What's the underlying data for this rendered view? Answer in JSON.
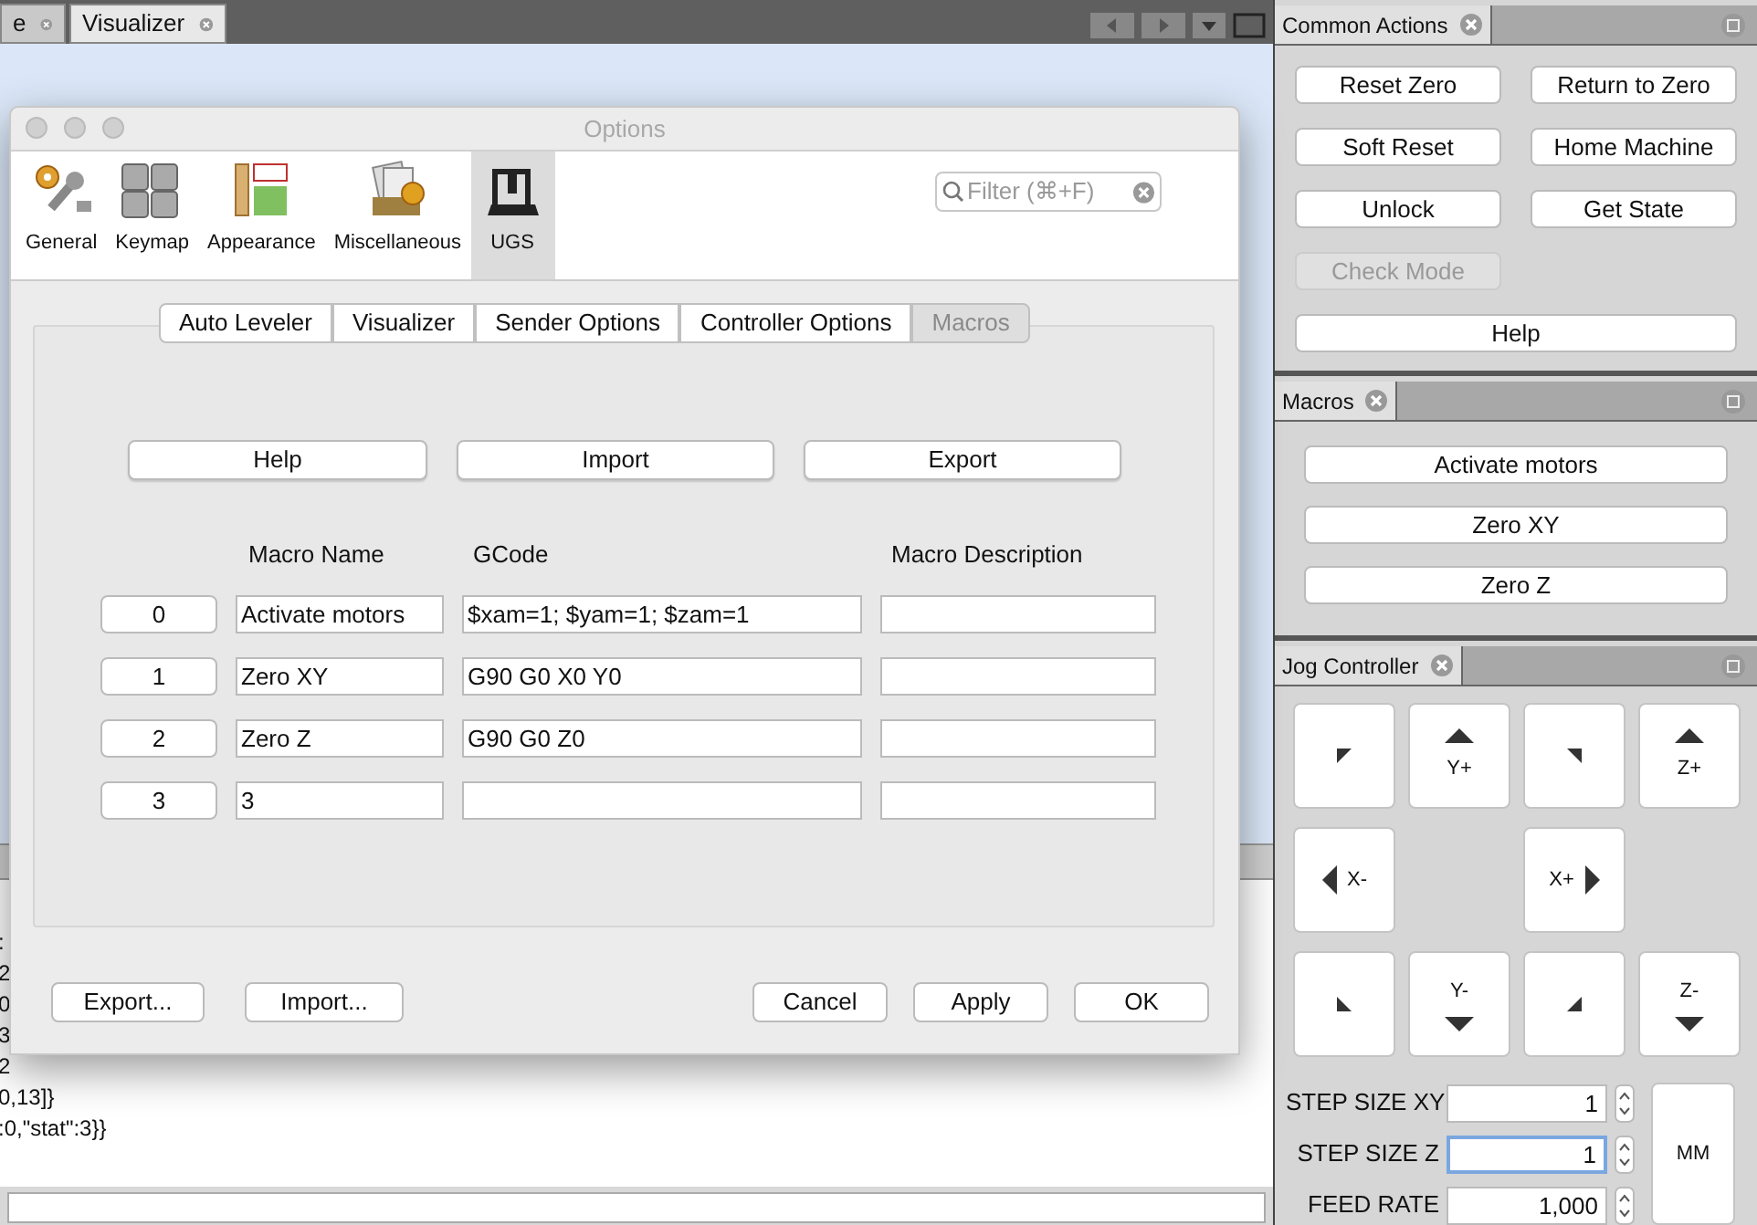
{
  "editor_tabs": [
    {
      "label": "e",
      "selected": false
    },
    {
      "label": "Visualizer",
      "selected": true
    }
  ],
  "console": {
    "lines": [
      ":",
      "2",
      "0",
      "3",
      "2",
      "0,13]}",
      ":0,\"stat\":3}}"
    ]
  },
  "dialog": {
    "title": "Options",
    "categories": [
      {
        "label": "General",
        "kind": "general",
        "selected": false
      },
      {
        "label": "Keymap",
        "kind": "keymap",
        "selected": false
      },
      {
        "label": "Appearance",
        "kind": "appearance",
        "selected": false
      },
      {
        "label": "Miscellaneous",
        "kind": "misc",
        "selected": false
      },
      {
        "label": "UGS",
        "kind": "ugs",
        "selected": true
      }
    ],
    "filter": {
      "placeholder": "Filter (⌘+F)"
    },
    "tabs": [
      {
        "label": "Auto Leveler",
        "selected": false
      },
      {
        "label": "Visualizer",
        "selected": false
      },
      {
        "label": "Sender Options",
        "selected": false
      },
      {
        "label": "Controller Options",
        "selected": false
      },
      {
        "label": "Macros",
        "selected": true
      }
    ],
    "top_buttons": [
      "Help",
      "Import",
      "Export"
    ],
    "columns": [
      "Macro Name",
      "GCode",
      "Macro Description"
    ],
    "macros": [
      {
        "index": "0",
        "name": "Activate motors",
        "gcode": "$xam=1; $yam=1; $zam=1"
      },
      {
        "index": "1",
        "name": "Zero XY",
        "gcode": "G90 G0 X0 Y0"
      },
      {
        "index": "2",
        "name": "Zero Z",
        "gcode": "G90 G0 Z0"
      },
      {
        "index": "3",
        "name": "3"
      }
    ],
    "left_buttons": [
      "Export...",
      "Import..."
    ],
    "right_buttons": [
      "Cancel",
      "Apply",
      "OK"
    ]
  },
  "common_actions": {
    "title": "Common Actions",
    "buttons": [
      {
        "label": "Reset Zero",
        "disabled": false
      },
      {
        "label": "Return to Zero",
        "disabled": false
      },
      {
        "label": "Soft Reset",
        "disabled": false
      },
      {
        "label": "Home Machine",
        "disabled": false
      },
      {
        "label": "Unlock",
        "disabled": false
      },
      {
        "label": "Get State",
        "disabled": false
      },
      {
        "label": "Check Mode",
        "disabled": true
      }
    ],
    "help": "Help"
  },
  "macros_panel": {
    "title": "Macros",
    "buttons": [
      "Activate motors",
      "Zero XY",
      "Zero Z"
    ]
  },
  "jog": {
    "title": "Jog Controller",
    "pad": [
      {
        "kind": "ul"
      },
      {
        "kind": "up",
        "label": "Y+"
      },
      {
        "kind": "ur"
      },
      {
        "kind": "up",
        "label": "Z+"
      },
      {
        "kind": "left",
        "label": "X-"
      },
      {
        "kind": "empty"
      },
      {
        "kind": "right",
        "label": "X+"
      },
      {
        "kind": "empty"
      },
      {
        "kind": "dl"
      },
      {
        "kind": "down",
        "label": "Y-"
      },
      {
        "kind": "dr"
      },
      {
        "kind": "down",
        "label": "Z-"
      }
    ],
    "fields": [
      {
        "label": "STEP SIZE XY",
        "value": "1",
        "focused": false
      },
      {
        "label": "STEP SIZE Z",
        "value": "1",
        "focused": true
      },
      {
        "label": "FEED RATE",
        "value": "1,000",
        "focused": false
      }
    ],
    "units": "MM"
  }
}
